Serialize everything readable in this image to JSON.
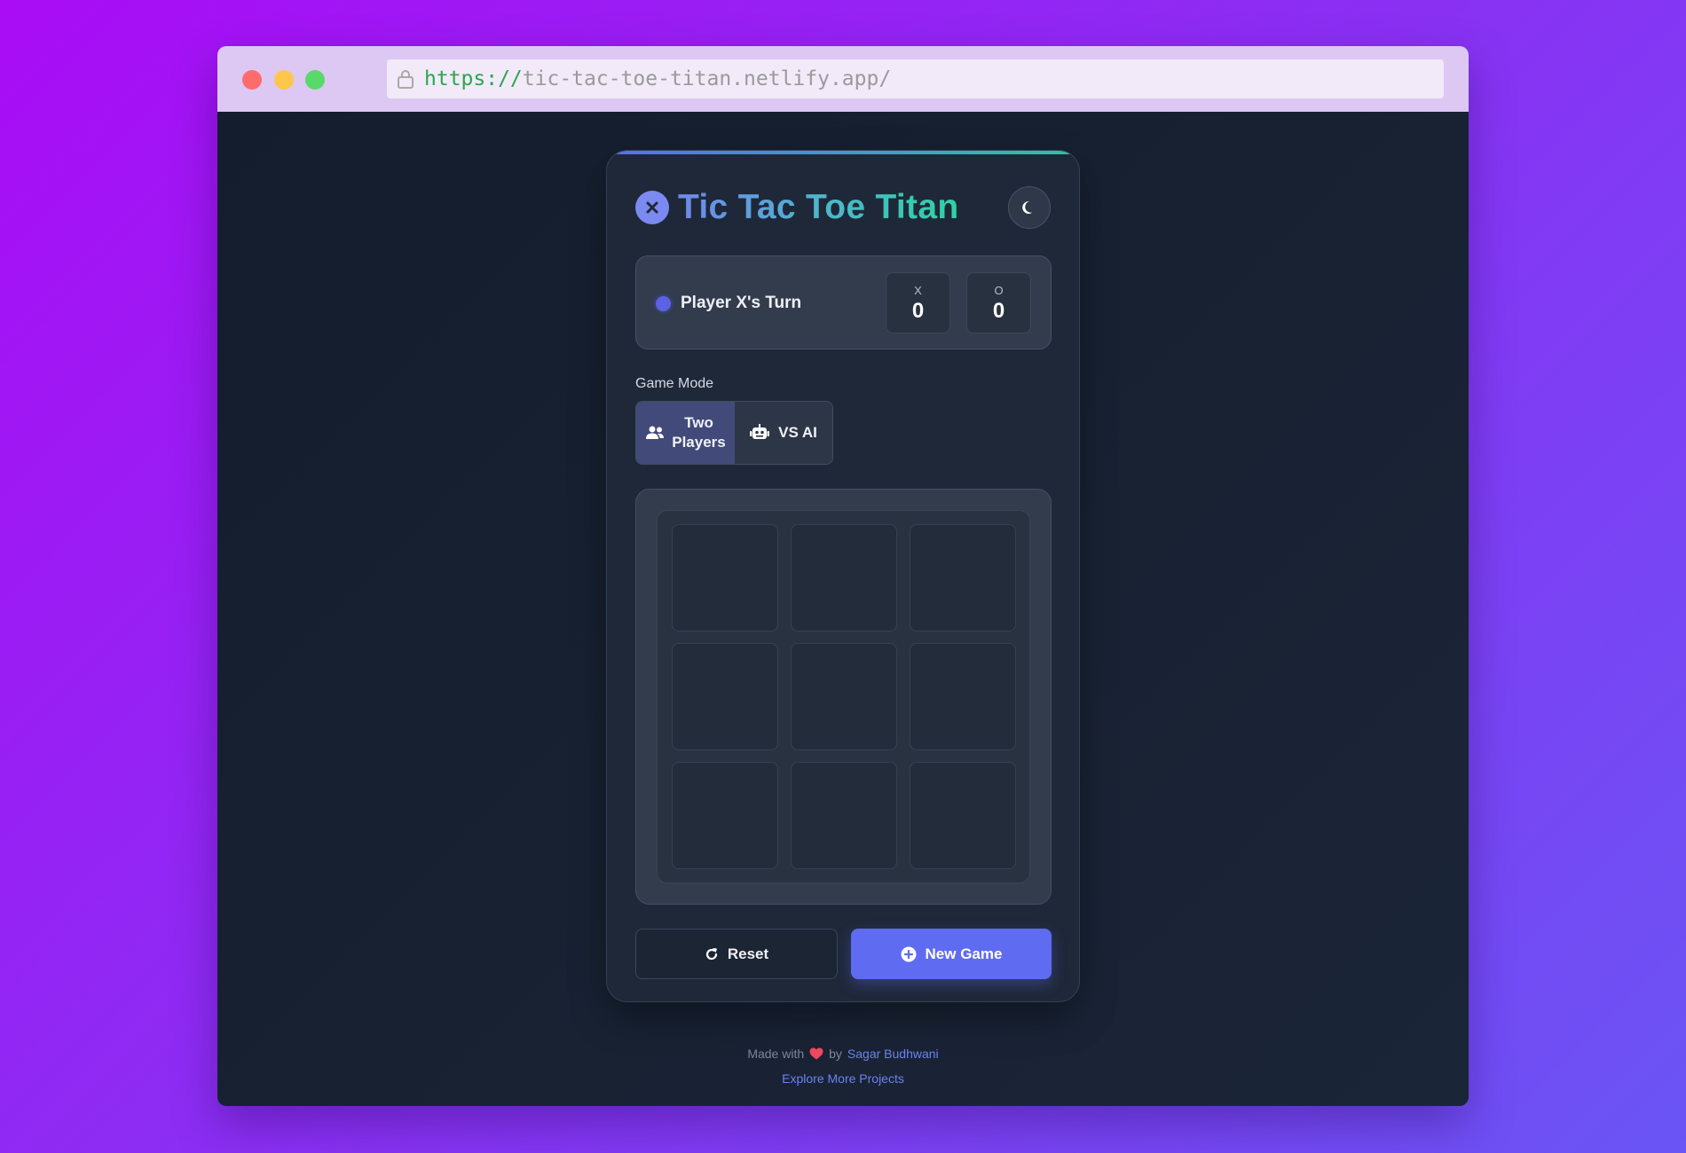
{
  "browser": {
    "url_protocol": "https://",
    "url_host": "tic-tac-toe-titan.netlify.app/"
  },
  "app": {
    "title": "Tic Tac Toe Titan",
    "turn_text": "Player X's Turn",
    "score_x_label": "X",
    "score_x_value": "0",
    "score_o_label": "O",
    "score_o_value": "0",
    "mode_label": "Game Mode",
    "mode_two_line1": "Two",
    "mode_two_line2": "Players",
    "mode_ai": "VS AI",
    "reset_label": "Reset",
    "new_game_label": "New Game",
    "active_mode": "Two Players",
    "theme": "dark",
    "board": [
      "",
      "",
      "",
      "",
      "",
      "",
      "",
      "",
      ""
    ]
  },
  "footer": {
    "made_with": "Made with",
    "by": "by",
    "author": "Sagar Budhwani",
    "explore": "Explore More Projects"
  },
  "colors": {
    "accent": "#5f6bf0",
    "title_gradient_start": "#6f88ec",
    "title_gradient_end": "#2ed3a4"
  },
  "icons": [
    "lock-icon",
    "close-icon",
    "moon-icon",
    "users-icon",
    "robot-icon",
    "redo-icon",
    "plus-circle-icon",
    "heart-icon"
  ]
}
